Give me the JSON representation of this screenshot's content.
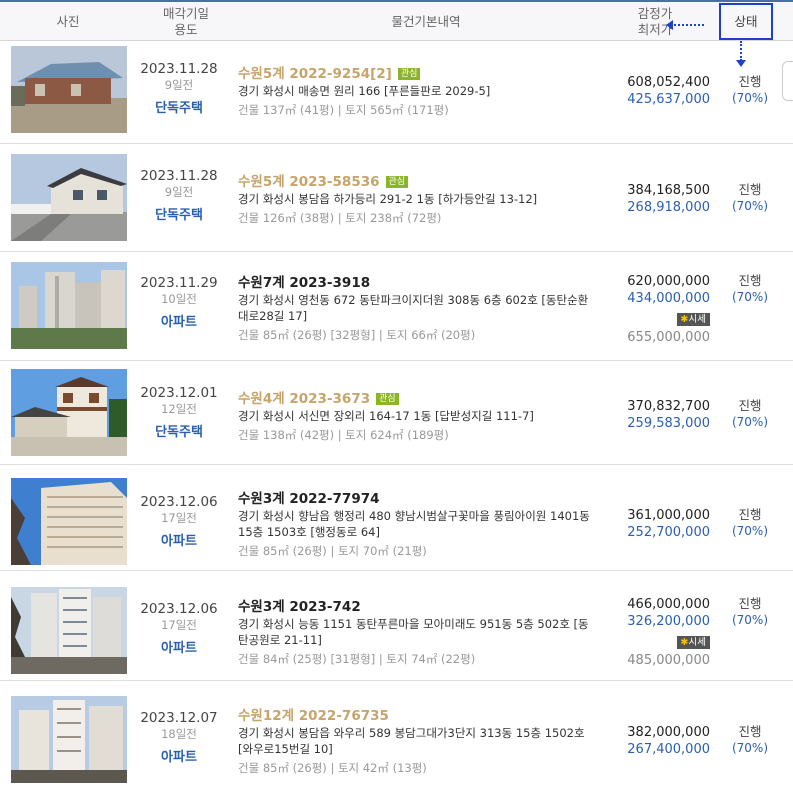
{
  "header": {
    "photo": "사진",
    "date_line1": "매각기일",
    "date_line2": "용도",
    "info": "물건기본내역",
    "price_line1": "감정가",
    "price_line2": "최저가",
    "status": "상태"
  },
  "rows": [
    {
      "date": "2023.11.28",
      "ago": "9일전",
      "type": "단독주택",
      "case": "수원5계 2022-9254[2]",
      "tag": "관심",
      "addr1": "경기 화성시 매송면 원리 166 [푸른들판로 2029-5]",
      "addr2": "",
      "size": "건물 137㎡ (41평)  |  토지 565㎡ (171평)",
      "appraisal": "608,052,400",
      "minimum": "425,637,000",
      "market_label": "",
      "market_price": "",
      "status": "진행",
      "pct": "(70%)"
    },
    {
      "date": "2023.11.28",
      "ago": "9일전",
      "type": "단독주택",
      "case": "수원5계 2023-58536",
      "tag": "관심",
      "addr1": "경기 화성시 봉담읍 하가등리 291-2 1동 [하가등안길 13-12]",
      "addr2": "",
      "size": "건물 126㎡ (38평)  |  토지 238㎡ (72평)",
      "appraisal": "384,168,500",
      "minimum": "268,918,000",
      "market_label": "",
      "market_price": "",
      "status": "진행",
      "pct": "(70%)"
    },
    {
      "date": "2023.11.29",
      "ago": "10일전",
      "type": "아파트",
      "case": "수원7계 2023-3918",
      "tag": "",
      "addr1": "경기 화성시 영천동 672 동탄파크이지더원 308동 6층 602호 [동탄순환",
      "addr2": "대로28길 17]",
      "size": "건물 85㎡ (26평) [32평형]  |  토지 66㎡ (20평)",
      "appraisal": "620,000,000",
      "minimum": "434,000,000",
      "market_label": "시세",
      "market_price": "655,000,000",
      "status": "진행",
      "pct": "(70%)"
    },
    {
      "date": "2023.12.01",
      "ago": "12일전",
      "type": "단독주택",
      "case": "수원4계 2023-3673",
      "tag": "관심",
      "addr1": "경기 화성시 서신면 장외리 164-17 1동 [답받성지길 111-7]",
      "addr2": "",
      "size": "건물 138㎡ (42평)  |  토지 624㎡ (189평)",
      "appraisal": "370,832,700",
      "minimum": "259,583,000",
      "market_label": "",
      "market_price": "",
      "status": "진행",
      "pct": "(70%)"
    },
    {
      "date": "2023.12.06",
      "ago": "17일전",
      "type": "아파트",
      "case": "수원3계 2022-77974",
      "tag": "",
      "addr1": "경기 화성시 향남읍 행정리 480 향남시범살구꽃마을 풍림아이원 1401동",
      "addr2": "15층 1503호 [행정동로 64]",
      "size": "건물 85㎡ (26평)  |  토지 70㎡ (21평)",
      "appraisal": "361,000,000",
      "minimum": "252,700,000",
      "market_label": "",
      "market_price": "",
      "status": "진행",
      "pct": "(70%)"
    },
    {
      "date": "2023.12.06",
      "ago": "17일전",
      "type": "아파트",
      "case": "수원3계 2023-742",
      "tag": "",
      "addr1": "경기 화성시 능동 1151 동탄푸른마을 모아미래도 951동 5층 502호 [동",
      "addr2": "탄공원로 21-11]",
      "size": "건물 84㎡ (25평) [31평형]  |  토지 74㎡ (22평)",
      "appraisal": "466,000,000",
      "minimum": "326,200,000",
      "market_label": "시세",
      "market_price": "485,000,000",
      "status": "진행",
      "pct": "(70%)"
    },
    {
      "date": "2023.12.07",
      "ago": "18일전",
      "type": "아파트",
      "case": "수원12계 2022-76735",
      "tag": "",
      "addr1": "경기 화성시 봉담읍 와우리 589 봉담그대가3단지 313동 15층 1502호",
      "addr2": "[와우로15번길 10]",
      "size": "건물 85㎡ (26평)  |  토지 42㎡ (13평)",
      "appraisal": "382,000,000",
      "minimum": "267,400,000",
      "market_label": "",
      "market_price": "",
      "status": "진행",
      "pct": "(70%)"
    }
  ],
  "colors": {
    "accent_blue": "#2a5fb0",
    "case_gold": "#c6a46a",
    "tag_green": "#8bb428",
    "highlight": "#1f3fcf"
  }
}
